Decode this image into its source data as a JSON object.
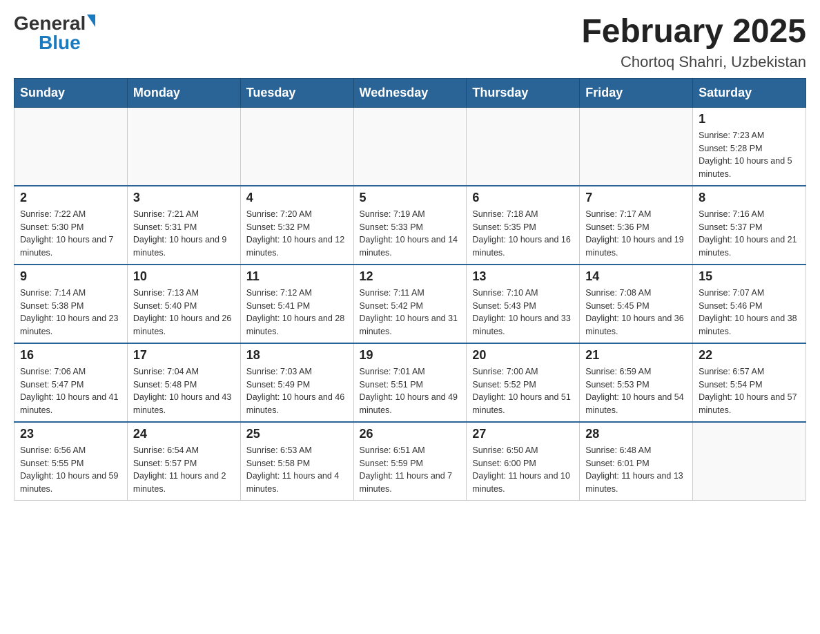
{
  "header": {
    "logo_general": "General",
    "logo_blue": "Blue",
    "month_year": "February 2025",
    "location": "Chortoq Shahri, Uzbekistan"
  },
  "weekdays": [
    "Sunday",
    "Monday",
    "Tuesday",
    "Wednesday",
    "Thursday",
    "Friday",
    "Saturday"
  ],
  "weeks": [
    [
      {
        "day": "",
        "info": ""
      },
      {
        "day": "",
        "info": ""
      },
      {
        "day": "",
        "info": ""
      },
      {
        "day": "",
        "info": ""
      },
      {
        "day": "",
        "info": ""
      },
      {
        "day": "",
        "info": ""
      },
      {
        "day": "1",
        "info": "Sunrise: 7:23 AM\nSunset: 5:28 PM\nDaylight: 10 hours and 5 minutes."
      }
    ],
    [
      {
        "day": "2",
        "info": "Sunrise: 7:22 AM\nSunset: 5:30 PM\nDaylight: 10 hours and 7 minutes."
      },
      {
        "day": "3",
        "info": "Sunrise: 7:21 AM\nSunset: 5:31 PM\nDaylight: 10 hours and 9 minutes."
      },
      {
        "day": "4",
        "info": "Sunrise: 7:20 AM\nSunset: 5:32 PM\nDaylight: 10 hours and 12 minutes."
      },
      {
        "day": "5",
        "info": "Sunrise: 7:19 AM\nSunset: 5:33 PM\nDaylight: 10 hours and 14 minutes."
      },
      {
        "day": "6",
        "info": "Sunrise: 7:18 AM\nSunset: 5:35 PM\nDaylight: 10 hours and 16 minutes."
      },
      {
        "day": "7",
        "info": "Sunrise: 7:17 AM\nSunset: 5:36 PM\nDaylight: 10 hours and 19 minutes."
      },
      {
        "day": "8",
        "info": "Sunrise: 7:16 AM\nSunset: 5:37 PM\nDaylight: 10 hours and 21 minutes."
      }
    ],
    [
      {
        "day": "9",
        "info": "Sunrise: 7:14 AM\nSunset: 5:38 PM\nDaylight: 10 hours and 23 minutes."
      },
      {
        "day": "10",
        "info": "Sunrise: 7:13 AM\nSunset: 5:40 PM\nDaylight: 10 hours and 26 minutes."
      },
      {
        "day": "11",
        "info": "Sunrise: 7:12 AM\nSunset: 5:41 PM\nDaylight: 10 hours and 28 minutes."
      },
      {
        "day": "12",
        "info": "Sunrise: 7:11 AM\nSunset: 5:42 PM\nDaylight: 10 hours and 31 minutes."
      },
      {
        "day": "13",
        "info": "Sunrise: 7:10 AM\nSunset: 5:43 PM\nDaylight: 10 hours and 33 minutes."
      },
      {
        "day": "14",
        "info": "Sunrise: 7:08 AM\nSunset: 5:45 PM\nDaylight: 10 hours and 36 minutes."
      },
      {
        "day": "15",
        "info": "Sunrise: 7:07 AM\nSunset: 5:46 PM\nDaylight: 10 hours and 38 minutes."
      }
    ],
    [
      {
        "day": "16",
        "info": "Sunrise: 7:06 AM\nSunset: 5:47 PM\nDaylight: 10 hours and 41 minutes."
      },
      {
        "day": "17",
        "info": "Sunrise: 7:04 AM\nSunset: 5:48 PM\nDaylight: 10 hours and 43 minutes."
      },
      {
        "day": "18",
        "info": "Sunrise: 7:03 AM\nSunset: 5:49 PM\nDaylight: 10 hours and 46 minutes."
      },
      {
        "day": "19",
        "info": "Sunrise: 7:01 AM\nSunset: 5:51 PM\nDaylight: 10 hours and 49 minutes."
      },
      {
        "day": "20",
        "info": "Sunrise: 7:00 AM\nSunset: 5:52 PM\nDaylight: 10 hours and 51 minutes."
      },
      {
        "day": "21",
        "info": "Sunrise: 6:59 AM\nSunset: 5:53 PM\nDaylight: 10 hours and 54 minutes."
      },
      {
        "day": "22",
        "info": "Sunrise: 6:57 AM\nSunset: 5:54 PM\nDaylight: 10 hours and 57 minutes."
      }
    ],
    [
      {
        "day": "23",
        "info": "Sunrise: 6:56 AM\nSunset: 5:55 PM\nDaylight: 10 hours and 59 minutes."
      },
      {
        "day": "24",
        "info": "Sunrise: 6:54 AM\nSunset: 5:57 PM\nDaylight: 11 hours and 2 minutes."
      },
      {
        "day": "25",
        "info": "Sunrise: 6:53 AM\nSunset: 5:58 PM\nDaylight: 11 hours and 4 minutes."
      },
      {
        "day": "26",
        "info": "Sunrise: 6:51 AM\nSunset: 5:59 PM\nDaylight: 11 hours and 7 minutes."
      },
      {
        "day": "27",
        "info": "Sunrise: 6:50 AM\nSunset: 6:00 PM\nDaylight: 11 hours and 10 minutes."
      },
      {
        "day": "28",
        "info": "Sunrise: 6:48 AM\nSunset: 6:01 PM\nDaylight: 11 hours and 13 minutes."
      },
      {
        "day": "",
        "info": ""
      }
    ]
  ]
}
